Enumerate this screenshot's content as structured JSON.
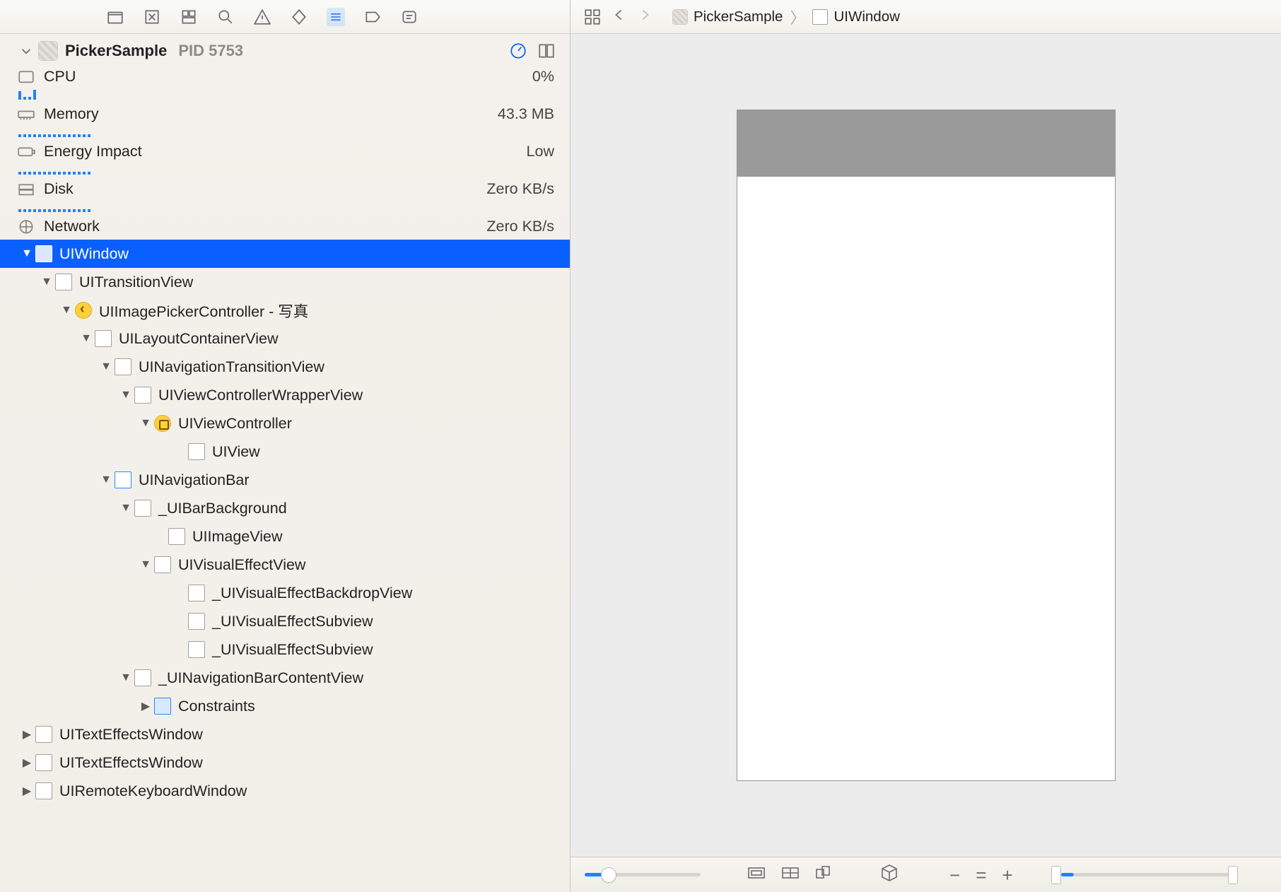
{
  "process": {
    "name": "PickerSample",
    "pid": "PID 5753"
  },
  "stats": {
    "cpu": {
      "label": "CPU",
      "value": "0%"
    },
    "memory": {
      "label": "Memory",
      "value": "43.3 MB"
    },
    "energy": {
      "label": "Energy Impact",
      "value": "Low"
    },
    "disk": {
      "label": "Disk",
      "value": "Zero KB/s"
    },
    "network": {
      "label": "Network",
      "value": "Zero KB/s"
    }
  },
  "tree": {
    "n0": "UIWindow",
    "n1": "UITransitionView",
    "n2": "UIImagePickerController - 写真",
    "n3": "UILayoutContainerView",
    "n4": "UINavigationTransitionView",
    "n5": "UIViewControllerWrapperView",
    "n6": "UIViewController",
    "n7": "UIView",
    "n8": "UINavigationBar",
    "n9": "_UIBarBackground",
    "n10": "UIImageView",
    "n11": "UIVisualEffectView",
    "n12": "_UIVisualEffectBackdropView",
    "n13": "_UIVisualEffectSubview",
    "n14": "_UIVisualEffectSubview",
    "n15": "_UINavigationBarContentView",
    "n16": "Constraints",
    "n17": "UITextEffectsWindow",
    "n18": "UITextEffectsWindow",
    "n19": "UIRemoteKeyboardWindow"
  },
  "breadcrumb": {
    "a": "PickerSample",
    "b": "UIWindow"
  }
}
